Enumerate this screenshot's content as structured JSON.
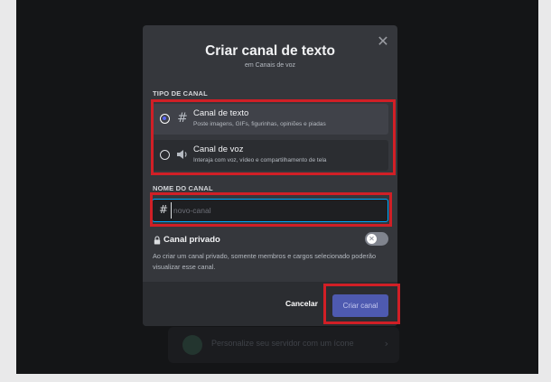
{
  "modal": {
    "title": "Criar canal de texto",
    "subtitle": "em Canais de voz",
    "close_icon": "close-icon"
  },
  "channel_type": {
    "section_label": "TIPO DE CANAL",
    "options": [
      {
        "icon": "hash-icon",
        "glyph": "#",
        "title": "Canal de texto",
        "description": "Poste imagens, GIFs, figurinhas, opiniões e piadas",
        "selected": true
      },
      {
        "icon": "speaker-icon",
        "glyph": "🔈",
        "title": "Canal de voz",
        "description": "Interaja com voz, vídeo e compartilhamento de tela",
        "selected": false
      }
    ]
  },
  "channel_name": {
    "section_label": "NOME DO CANAL",
    "prefix": "#",
    "value": "",
    "placeholder": "novo-canal"
  },
  "private": {
    "label": "Canal privado",
    "enabled": false,
    "description": "Ao criar um canal privado, somente membros e cargos selecionado poderão visualizar esse canal."
  },
  "footer": {
    "cancel_label": "Cancelar",
    "create_label": "Criar canal"
  },
  "background": {
    "card_text": "Personalize seu servidor com um ícone"
  },
  "colors": {
    "accent": "#5865f2",
    "highlight": "#d11f26",
    "modal_bg": "#35373c"
  }
}
